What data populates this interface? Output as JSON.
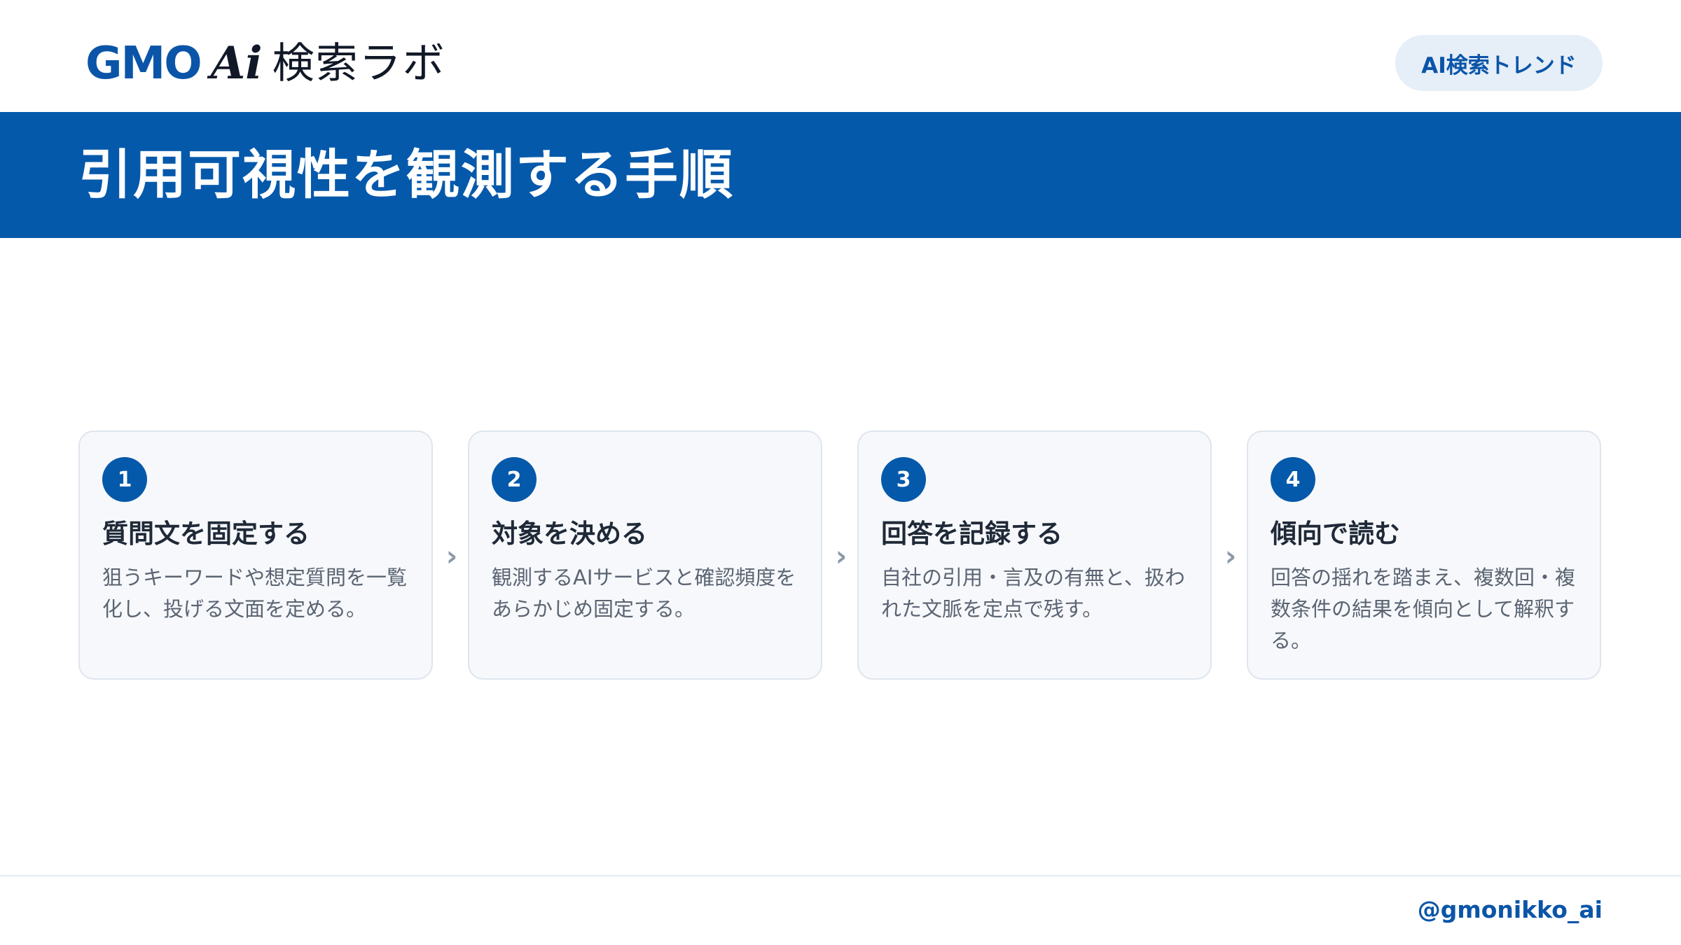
{
  "header": {
    "logo": {
      "brand": "GMO",
      "ai": "Ai",
      "lab": "検索ラボ"
    },
    "tag": "AI検索トレンド"
  },
  "banner": {
    "title": "引用可視性を観測する手順"
  },
  "steps": [
    {
      "number": "1",
      "title": "質問文を固定する",
      "description": "狙うキーワードや想定質問を一覧化し、投げる文面を定める。"
    },
    {
      "number": "2",
      "title": "対象を決める",
      "description": "観測するAIサービスと確認頻度をあらかじめ固定する。"
    },
    {
      "number": "3",
      "title": "回答を記録する",
      "description": "自社の引用・言及の有無と、扱われた文脈を定点で残す。"
    },
    {
      "number": "4",
      "title": "傾向で読む",
      "description": "回答の揺れを踏まえ、複数回・複数条件の結果を傾向として解釈する。"
    }
  ],
  "footer": {
    "handle": "@gmonikko_ai"
  }
}
